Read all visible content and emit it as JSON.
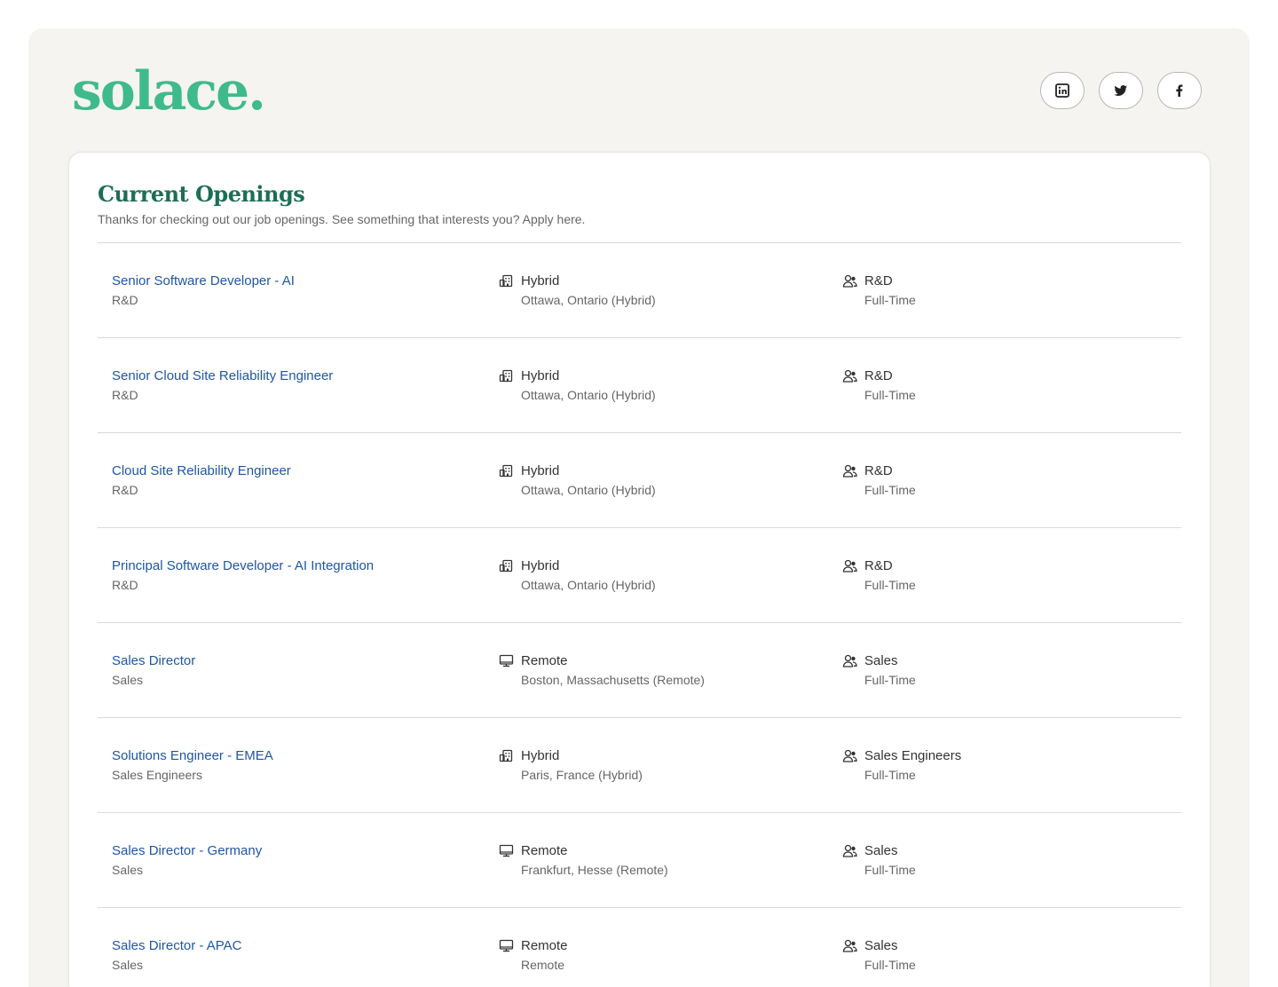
{
  "brand": {
    "logo_text": "solace.",
    "color": "#3fba8e"
  },
  "social": [
    {
      "name": "linkedin-icon"
    },
    {
      "name": "twitter-icon"
    },
    {
      "name": "facebook-icon"
    }
  ],
  "header": {
    "title": "Current Openings",
    "subtitle": "Thanks for checking out our job openings. See something that interests you? Apply here."
  },
  "jobs": [
    {
      "title": "Senior Software Developer - AI",
      "department": "R&D",
      "workplace": "Hybrid",
      "location": "Ottawa, Ontario (Hybrid)",
      "team": "R&D",
      "type": "Full-Time",
      "workplace_icon": "building-icon"
    },
    {
      "title": "Senior Cloud Site Reliability Engineer",
      "department": "R&D",
      "workplace": "Hybrid",
      "location": "Ottawa, Ontario (Hybrid)",
      "team": "R&D",
      "type": "Full-Time",
      "workplace_icon": "building-icon"
    },
    {
      "title": "Cloud Site Reliability Engineer",
      "department": "R&D",
      "workplace": "Hybrid",
      "location": "Ottawa, Ontario (Hybrid)",
      "team": "R&D",
      "type": "Full-Time",
      "workplace_icon": "building-icon"
    },
    {
      "title": "Principal Software Developer - AI Integration",
      "department": "R&D",
      "workplace": "Hybrid",
      "location": "Ottawa, Ontario (Hybrid)",
      "team": "R&D",
      "type": "Full-Time",
      "workplace_icon": "building-icon"
    },
    {
      "title": "Sales Director",
      "department": "Sales",
      "workplace": "Remote",
      "location": "Boston, Massachusetts (Remote)",
      "team": "Sales",
      "type": "Full-Time",
      "workplace_icon": "monitor-icon"
    },
    {
      "title": "Solutions Engineer - EMEA",
      "department": "Sales Engineers",
      "workplace": "Hybrid",
      "location": "Paris, France (Hybrid)",
      "team": "Sales Engineers",
      "type": "Full-Time",
      "workplace_icon": "building-icon"
    },
    {
      "title": "Sales Director - Germany",
      "department": "Sales",
      "workplace": "Remote",
      "location": "Frankfurt, Hesse (Remote)",
      "team": "Sales",
      "type": "Full-Time",
      "workplace_icon": "monitor-icon"
    },
    {
      "title": "Sales Director - APAC",
      "department": "Sales",
      "workplace": "Remote",
      "location": "Remote",
      "team": "Sales",
      "type": "Full-Time",
      "workplace_icon": "monitor-icon"
    }
  ]
}
